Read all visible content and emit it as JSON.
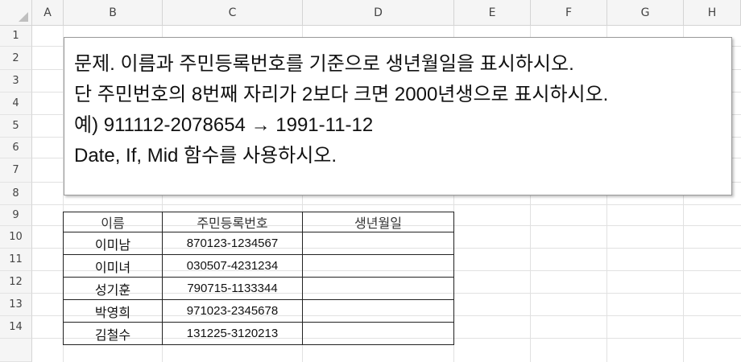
{
  "spreadsheet": {
    "columns": [
      "A",
      "B",
      "C",
      "D",
      "E",
      "F",
      "G",
      "H"
    ],
    "rows": [
      "1",
      "2",
      "3",
      "4",
      "5",
      "6",
      "7",
      "8",
      "9",
      "10",
      "11",
      "12",
      "13",
      "14"
    ]
  },
  "instruction_box": {
    "lines": [
      "문제. 이름과 주민등록번호를 기준으로 생년월일을 표시하시오.",
      "단 주민번호의 8번째 자리가 2보다 크면 2000년생으로 표시하시오.",
      "예) 911112-2078654 → 1991-11-12",
      "Date, If, Mid 함수를 사용하시오."
    ]
  },
  "table": {
    "headers": [
      "이름",
      "주민등록번호",
      "생년월일"
    ],
    "rows": [
      {
        "name": "이미남",
        "id": "870123-1234567",
        "birth": ""
      },
      {
        "name": "이미녀",
        "id": "030507-4231234",
        "birth": ""
      },
      {
        "name": "성기훈",
        "id": "790715-1133344",
        "birth": ""
      },
      {
        "name": "박영희",
        "id": "971023-2345678",
        "birth": ""
      },
      {
        "name": "김철수",
        "id": "131225-3120213",
        "birth": ""
      }
    ]
  }
}
